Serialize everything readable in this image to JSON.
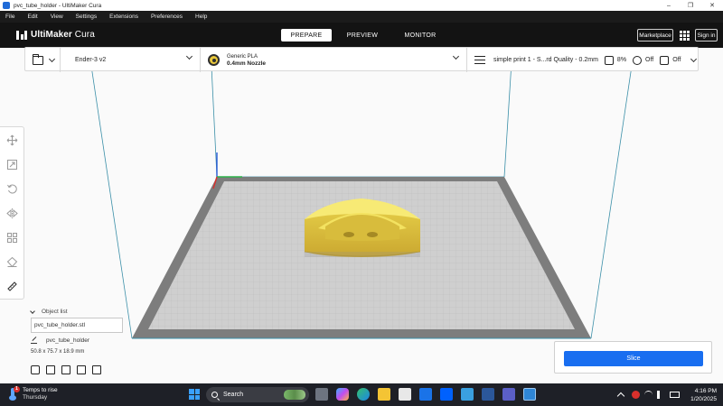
{
  "window": {
    "title": "pvc_tube_holder - UltiMaker Cura",
    "controls": [
      "–",
      "❐",
      "✕"
    ]
  },
  "menu": {
    "items": [
      "File",
      "Edit",
      "View",
      "Settings",
      "Extensions",
      "Preferences",
      "Help"
    ]
  },
  "header": {
    "brand_bold": "UltiMaker",
    "brand_regular": " Cura",
    "tabs": [
      "PREPARE",
      "PREVIEW",
      "MONITOR"
    ],
    "active_tab": "PREPARE",
    "marketplace_label": "Marketplace",
    "signin_label": "Sign in"
  },
  "toolbar": {
    "printer": "Ender-3 v2",
    "material_name": "Generic PLA",
    "nozzle": "0.4mm Nozzle",
    "profile": "simple print 1 - S...rd Quality - 0.2mm",
    "infill": "8%",
    "support": "Off",
    "adhesion": "Off"
  },
  "object_list": {
    "header": "Object list",
    "file": "pvc_tube_holder.stl",
    "object_name": "pvc_tube_holder",
    "dimensions": "50.8 x 75.7 x 18.9 mm"
  },
  "slice": {
    "label": "Slice"
  },
  "taskbar": {
    "weather_line1": "Temps to rise",
    "weather_line2": "Thursday",
    "weather_badge": "1",
    "search_label": "Search",
    "time": "4:16 PM",
    "date": "1/20/2025"
  },
  "colors": {
    "accent": "#196ef0",
    "model": "#f5e35a",
    "build_plate": "#c9c9c9",
    "header_bg": "#131313"
  }
}
